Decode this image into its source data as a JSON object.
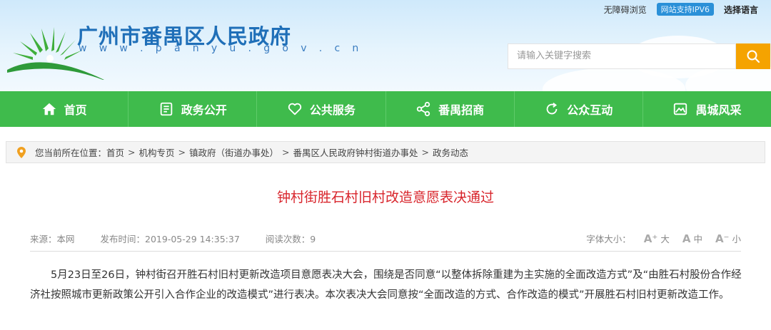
{
  "header": {
    "title": "广州市番禺区人民政府",
    "url": "w w w . p a n y u . g o v . c n",
    "barrier_free": "无障碍浏览",
    "ipv6": "网站支持IPV6",
    "language": "选择语言"
  },
  "search": {
    "placeholder": "请输入关键字搜索"
  },
  "nav": [
    {
      "label": "首页",
      "icon": "home-icon"
    },
    {
      "label": "政务公开",
      "icon": "document-icon"
    },
    {
      "label": "公共服务",
      "icon": "heart-icon"
    },
    {
      "label": "番禺招商",
      "icon": "share-icon"
    },
    {
      "label": "公众互动",
      "icon": "refresh-icon"
    },
    {
      "label": "禺城风采",
      "icon": "picture-icon"
    }
  ],
  "breadcrumb": {
    "prefix": "您当前所在位置：",
    "items": [
      "首页",
      "机构专页",
      "镇政府（街道办事处）",
      "番禺区人民政府钟村街道办事处",
      "政务动态"
    ],
    "separator": ">"
  },
  "article": {
    "title": "钟村街胜石村旧村改造意愿表决通过",
    "source": "来源：本网",
    "publish_time": "发布时间：2019-05-29 14:35:37",
    "views": "阅读次数：9",
    "body": "5月23日至26日，钟村街召开胜石村旧村更新改造项目意愿表决大会，围绕是否同意“以整体拆除重建为主实施的全面改造方式”及“由胜石村股份合作经济社按照城市更新政策公开引入合作企业的改造模式”进行表决。本次表决大会同意按“全面改造的方式、合作改造的模式”开展胜石村旧村更新改造工作。"
  },
  "font_size": {
    "label": "字体大小：",
    "large": "大",
    "medium": "中",
    "small": "小"
  },
  "colors": {
    "nav_green": "#3fbb4c",
    "title_red": "#d8242b",
    "search_orange": "#f5a300",
    "site_blue": "#1f6fb8"
  }
}
